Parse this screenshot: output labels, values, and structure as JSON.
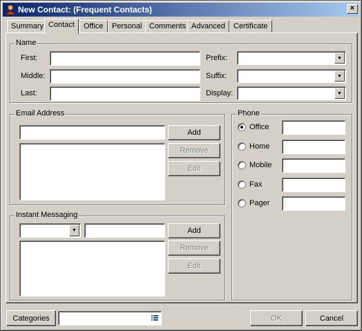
{
  "window": {
    "title": "New Contact: (Frequent Contacts)",
    "close_glyph": "×"
  },
  "tabs": [
    {
      "label": "Summary"
    },
    {
      "label": "Contact",
      "active": true
    },
    {
      "label": "Office"
    },
    {
      "label": "Personal"
    },
    {
      "label": "Comments"
    },
    {
      "label": "Advanced"
    },
    {
      "label": "Certificate"
    }
  ],
  "name_group": {
    "label": "Name",
    "first_label": "First:",
    "middle_label": "Middle:",
    "last_label": "Last:",
    "first_value": "",
    "middle_value": "",
    "last_value": "",
    "prefix_label": "Prefix:",
    "suffix_label": "Suffix:",
    "display_label": "Display:",
    "prefix_value": "",
    "suffix_value": "",
    "display_value": ""
  },
  "email_group": {
    "label": "Email Address",
    "input_value": "",
    "add": "Add",
    "remove": "Remove",
    "edit": "Edit"
  },
  "im_group": {
    "label": "Instant Messaging",
    "service_value": "",
    "input_value": "",
    "add": "Add",
    "remove": "Remove",
    "edit": "Edit"
  },
  "phone_group": {
    "label": "Phone",
    "options": [
      {
        "label": "Office",
        "selected": true
      },
      {
        "label": "Home",
        "selected": false
      },
      {
        "label": "Mobile",
        "selected": false
      },
      {
        "label": "Fax",
        "selected": false
      },
      {
        "label": "Pager",
        "selected": false
      }
    ]
  },
  "footer": {
    "categories": "Categories",
    "categories_value": "",
    "ok": "OK",
    "cancel": "Cancel"
  },
  "icons": {
    "app": "contact-icon",
    "close": "close-icon",
    "dropdown": "chevron-down-icon",
    "list": "list-icon"
  }
}
